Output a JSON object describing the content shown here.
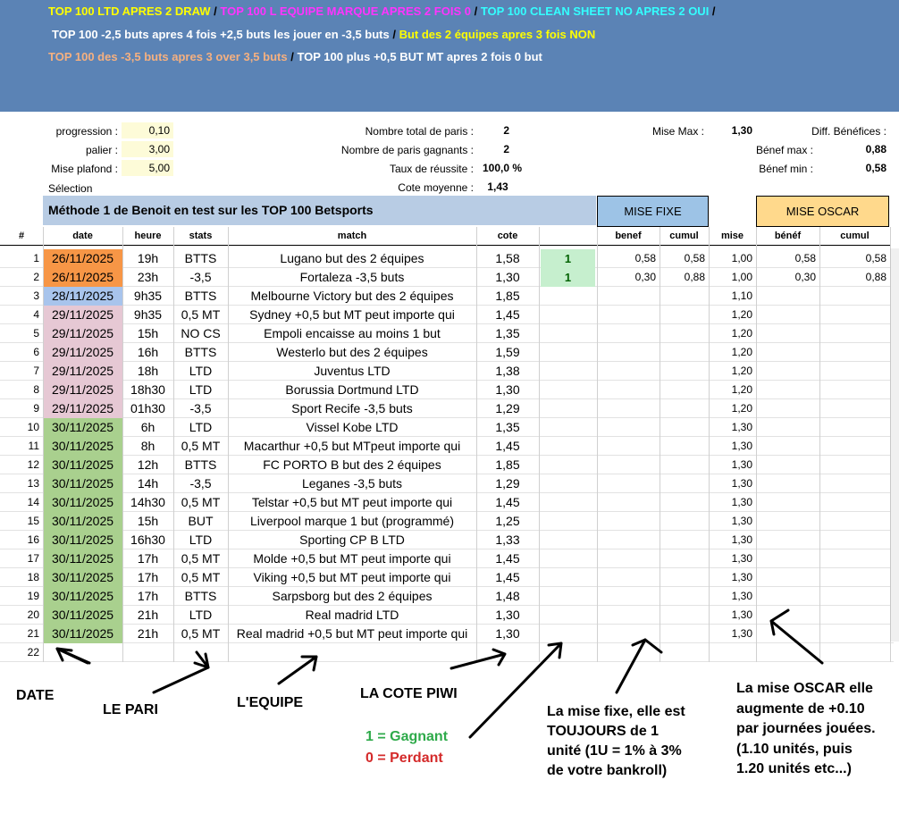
{
  "header": {
    "line1": [
      {
        "text": "TOP 100 LTD APRES 2 DRAW",
        "color": "#ffff00"
      },
      {
        "text": " / ",
        "color": "#000000"
      },
      {
        "text": "TOP 100 L EQUIPE MARQUE APRES 2 FOIS 0",
        "color": "#ff33ff"
      },
      {
        "text": " / ",
        "color": "#000000"
      },
      {
        "text": "TOP 100 CLEAN SHEET NO APRES 2 OUI",
        "color": "#33ffff"
      },
      {
        "text": " /",
        "color": "#000000"
      }
    ],
    "line2": [
      {
        "text": "TOP 100 -2,5 buts apres 4 fois +2,5 buts les jouer en -3,5 buts",
        "color": "#ffffff"
      },
      {
        "text": " / ",
        "color": "#000000"
      },
      {
        "text": "But des 2 équipes apres 3 fois NON",
        "color": "#ffff00"
      }
    ],
    "line3": [
      {
        "text": "TOP 100 des -3,5 buts apres 3 over 3,5 buts",
        "color": "#f5b080"
      },
      {
        "text": " / ",
        "color": "#000000"
      },
      {
        "text": "TOP 100 plus +0,5 BUT MT apres 2 fois 0 but",
        "color": "#ffffff"
      }
    ]
  },
  "stats": {
    "progression_label": "progression :",
    "progression_value": "0,10",
    "palier_label": "palier :",
    "palier_value": "3,00",
    "mise_plafond_label": "Mise plafond :",
    "mise_plafond_value": "5,00",
    "selection_label": "Sélection",
    "nb_total_label": "Nombre total de paris :",
    "nb_total_value": "2",
    "nb_gagnants_label": "Nombre de paris gagnants :",
    "nb_gagnants_value": "2",
    "taux_label": "Taux de réussite :",
    "taux_value": "100,0 %",
    "cote_moy_label": "Cote moyenne :",
    "cote_moy_value": "1,43",
    "mise_max_label": "Mise Max :",
    "mise_max_value": "1,30",
    "diff_label": "Diff. Bénéfices :",
    "benef_max_label": "Bénef max :",
    "benef_max_value": "0,88",
    "benef_min_label": "Bénef min :",
    "benef_min_value": "0,58"
  },
  "banner": {
    "title": "Méthode 1 de Benoit en test sur les TOP 100 Betsports",
    "mise_fixe": "MISE FIXE",
    "mise_oscar": "MISE OSCAR"
  },
  "columns": {
    "num": "#",
    "date": "date",
    "heure": "heure",
    "stats": "stats",
    "match": "match",
    "cote": "cote",
    "benef": "benef",
    "cumul": "cumul",
    "mise": "mise",
    "benef2": "bénéf",
    "cumul2": "cumul"
  },
  "colors": {
    "date_orange": "#f79646",
    "date_blue": "#a8c4ec",
    "date_pink": "#e6c8d4",
    "date_green": "#a9d08e",
    "result_green": "#c6efce",
    "result_text": "#006100"
  },
  "rows": [
    {
      "n": "1",
      "date": "26/11/2025",
      "date_color": "orange",
      "heure": "19h",
      "stats": "BTTS",
      "match": "Lugano but des 2 équipes",
      "cote": "1,58",
      "result": "1",
      "benef": "0,58",
      "cumul": "0,58",
      "mise": "1,00",
      "benef2": "0,58",
      "cumul2": "0,58"
    },
    {
      "n": "2",
      "date": "26/11/2025",
      "date_color": "orange",
      "heure": "23h",
      "stats": "-3,5",
      "match": "Fortaleza -3,5 buts",
      "cote": "1,30",
      "result": "1",
      "benef": "0,30",
      "cumul": "0,88",
      "mise": "1,00",
      "benef2": "0,30",
      "cumul2": "0,88"
    },
    {
      "n": "3",
      "date": "28/11/2025",
      "date_color": "blue",
      "heure": "9h35",
      "stats": "BTTS",
      "match": "Melbourne Victory but des 2 équipes",
      "cote": "1,85",
      "result": "",
      "benef": "",
      "cumul": "",
      "mise": "1,10",
      "benef2": "",
      "cumul2": ""
    },
    {
      "n": "4",
      "date": "29/11/2025",
      "date_color": "pink",
      "heure": "9h35",
      "stats": "0,5 MT",
      "match": "Sydney +0,5 but MT peut importe qui",
      "cote": "1,45",
      "result": "",
      "benef": "",
      "cumul": "",
      "mise": "1,20",
      "benef2": "",
      "cumul2": ""
    },
    {
      "n": "5",
      "date": "29/11/2025",
      "date_color": "pink",
      "heure": "15h",
      "stats": "NO CS",
      "match": "Empoli encaisse au moins 1 but",
      "cote": "1,35",
      "result": "",
      "benef": "",
      "cumul": "",
      "mise": "1,20",
      "benef2": "",
      "cumul2": ""
    },
    {
      "n": "6",
      "date": "29/11/2025",
      "date_color": "pink",
      "heure": "16h",
      "stats": "BTTS",
      "match": "Westerlo but des 2 équipes",
      "cote": "1,59",
      "result": "",
      "benef": "",
      "cumul": "",
      "mise": "1,20",
      "benef2": "",
      "cumul2": ""
    },
    {
      "n": "7",
      "date": "29/11/2025",
      "date_color": "pink",
      "heure": "18h",
      "stats": "LTD",
      "match": "Juventus LTD",
      "cote": "1,38",
      "result": "",
      "benef": "",
      "cumul": "",
      "mise": "1,20",
      "benef2": "",
      "cumul2": ""
    },
    {
      "n": "8",
      "date": "29/11/2025",
      "date_color": "pink",
      "heure": "18h30",
      "stats": "LTD",
      "match": "Borussia Dortmund LTD",
      "cote": "1,30",
      "result": "",
      "benef": "",
      "cumul": "",
      "mise": "1,20",
      "benef2": "",
      "cumul2": ""
    },
    {
      "n": "9",
      "date": "29/11/2025",
      "date_color": "pink",
      "heure": "01h30",
      "stats": "-3,5",
      "match": "Sport Recife -3,5 buts",
      "cote": "1,29",
      "result": "",
      "benef": "",
      "cumul": "",
      "mise": "1,20",
      "benef2": "",
      "cumul2": ""
    },
    {
      "n": "10",
      "date": "30/11/2025",
      "date_color": "green",
      "heure": "6h",
      "stats": "LTD",
      "match": "Vissel Kobe LTD",
      "cote": "1,35",
      "result": "",
      "benef": "",
      "cumul": "",
      "mise": "1,30",
      "benef2": "",
      "cumul2": ""
    },
    {
      "n": "11",
      "date": "30/11/2025",
      "date_color": "green",
      "heure": "8h",
      "stats": "0,5 MT",
      "match": "Macarthur +0,5 but MTpeut importe qui",
      "cote": "1,45",
      "result": "",
      "benef": "",
      "cumul": "",
      "mise": "1,30",
      "benef2": "",
      "cumul2": ""
    },
    {
      "n": "12",
      "date": "30/11/2025",
      "date_color": "green",
      "heure": "12h",
      "stats": "BTTS",
      "match": "FC PORTO B but des 2 équipes",
      "cote": "1,85",
      "result": "",
      "benef": "",
      "cumul": "",
      "mise": "1,30",
      "benef2": "",
      "cumul2": ""
    },
    {
      "n": "13",
      "date": "30/11/2025",
      "date_color": "green",
      "heure": "14h",
      "stats": "-3,5",
      "match": "Leganes -3,5 buts",
      "cote": "1,29",
      "result": "",
      "benef": "",
      "cumul": "",
      "mise": "1,30",
      "benef2": "",
      "cumul2": ""
    },
    {
      "n": "14",
      "date": "30/11/2025",
      "date_color": "green",
      "heure": "14h30",
      "stats": "0,5 MT",
      "match": "Telstar +0,5 but MT peut importe qui",
      "cote": "1,45",
      "result": "",
      "benef": "",
      "cumul": "",
      "mise": "1,30",
      "benef2": "",
      "cumul2": ""
    },
    {
      "n": "15",
      "date": "30/11/2025",
      "date_color": "green",
      "heure": "15h",
      "stats": "BUT",
      "match": "Liverpool marque 1 but (programmé)",
      "cote": "1,25",
      "result": "",
      "benef": "",
      "cumul": "",
      "mise": "1,30",
      "benef2": "",
      "cumul2": ""
    },
    {
      "n": "16",
      "date": "30/11/2025",
      "date_color": "green",
      "heure": "16h30",
      "stats": "LTD",
      "match": "Sporting CP B LTD",
      "cote": "1,33",
      "result": "",
      "benef": "",
      "cumul": "",
      "mise": "1,30",
      "benef2": "",
      "cumul2": ""
    },
    {
      "n": "17",
      "date": "30/11/2025",
      "date_color": "green",
      "heure": "17h",
      "stats": "0,5 MT",
      "match": "Molde +0,5 but MT peut importe qui",
      "cote": "1,45",
      "result": "",
      "benef": "",
      "cumul": "",
      "mise": "1,30",
      "benef2": "",
      "cumul2": ""
    },
    {
      "n": "18",
      "date": "30/11/2025",
      "date_color": "green",
      "heure": "17h",
      "stats": "0,5 MT",
      "match": "Viking +0,5 but MT peut importe qui",
      "cote": "1,45",
      "result": "",
      "benef": "",
      "cumul": "",
      "mise": "1,30",
      "benef2": "",
      "cumul2": ""
    },
    {
      "n": "19",
      "date": "30/11/2025",
      "date_color": "green",
      "heure": "17h",
      "stats": "BTTS",
      "match": "Sarpsborg but des 2 équipes",
      "cote": "1,48",
      "result": "",
      "benef": "",
      "cumul": "",
      "mise": "1,30",
      "benef2": "",
      "cumul2": ""
    },
    {
      "n": "20",
      "date": "30/11/2025",
      "date_color": "green",
      "heure": "21h",
      "stats": "LTD",
      "match": "Real madrid LTD",
      "cote": "1,30",
      "result": "",
      "benef": "",
      "cumul": "",
      "mise": "1,30",
      "benef2": "",
      "cumul2": ""
    },
    {
      "n": "21",
      "date": "30/11/2025",
      "date_color": "green",
      "heure": "21h",
      "stats": "0,5 MT",
      "match": "Real madrid +0,5 but MT peut importe qui",
      "cote": "1,30",
      "result": "",
      "benef": "",
      "cumul": "",
      "mise": "1,30",
      "benef2": "",
      "cumul2": ""
    },
    {
      "n": "22",
      "date": "",
      "date_color": "none",
      "heure": "",
      "stats": "",
      "match": "",
      "cote": "",
      "result": "",
      "benef": "",
      "cumul": "",
      "mise": "",
      "benef2": "",
      "cumul2": ""
    }
  ],
  "annotations": {
    "date": "DATE",
    "pari": "LE PARI",
    "equipe": "L'EQUIPE",
    "cote": "LA COTE PIWI",
    "gagnant": "1 = Gagnant",
    "perdant": "0 = Perdant",
    "gagnant_color": "#2eaa4a",
    "perdant_color": "#d42a2a",
    "mise_fixe_lines": [
      "La mise fixe, elle est",
      "TOUJOURS de 1",
      "unité (1U = 1% à 3%",
      "de votre bankroll)"
    ],
    "mise_oscar_lines": [
      "La mise OSCAR elle",
      "augmente de +0.10",
      "par journées jouées.",
      "(1.10 unités, puis",
      "1.20 unités etc...)"
    ]
  }
}
